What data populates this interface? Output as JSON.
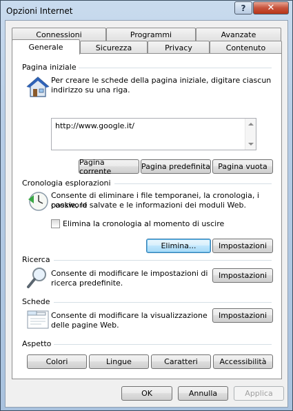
{
  "window": {
    "title": "Opzioni Internet",
    "help_label": "?",
    "close_label": "✕"
  },
  "tabs_row1": [
    "Connessioni",
    "Programmi",
    "Avanzate"
  ],
  "tabs_row2": [
    "Generale",
    "Sicurezza",
    "Privacy",
    "Contenuto"
  ],
  "home": {
    "title": "Pagina iniziale",
    "desc_line1": "Per creare le schede della pagina iniziale, digitare ciascun",
    "desc_line2": "indirizzo su una riga.",
    "url": "http://www.google.it/",
    "btn_current": "Pagina corrente",
    "btn_default": "Pagina predefinita",
    "btn_blank": "Pagina vuota"
  },
  "history": {
    "title": "Cronologia esplorazioni",
    "desc_line1": "Consente di eliminare i file temporanei, la cronologia, i cookie, le",
    "desc_line2": "password salvate e le informazioni dei moduli Web.",
    "checkbox_label": "Elimina la cronologia al momento di uscire",
    "checkbox_checked": false,
    "btn_delete": "Elimina...",
    "btn_settings": "Impostazioni"
  },
  "search": {
    "title": "Ricerca",
    "desc_line1": "Consente di modificare le impostazioni di",
    "desc_line2": "ricerca predefinite.",
    "btn_settings": "Impostazioni"
  },
  "tabs_section": {
    "title": "Schede",
    "desc_line1": "Consente di modificare la visualizzazione",
    "desc_line2": "delle pagine Web.",
    "btn_settings": "Impostazioni"
  },
  "appearance": {
    "title": "Aspetto",
    "btn_colors": "Colori",
    "btn_languages": "Lingue",
    "btn_fonts": "Caratteri",
    "btn_accessibility": "Accessibilità"
  },
  "footer": {
    "ok": "OK",
    "cancel": "Annulla",
    "apply": "Applica"
  }
}
